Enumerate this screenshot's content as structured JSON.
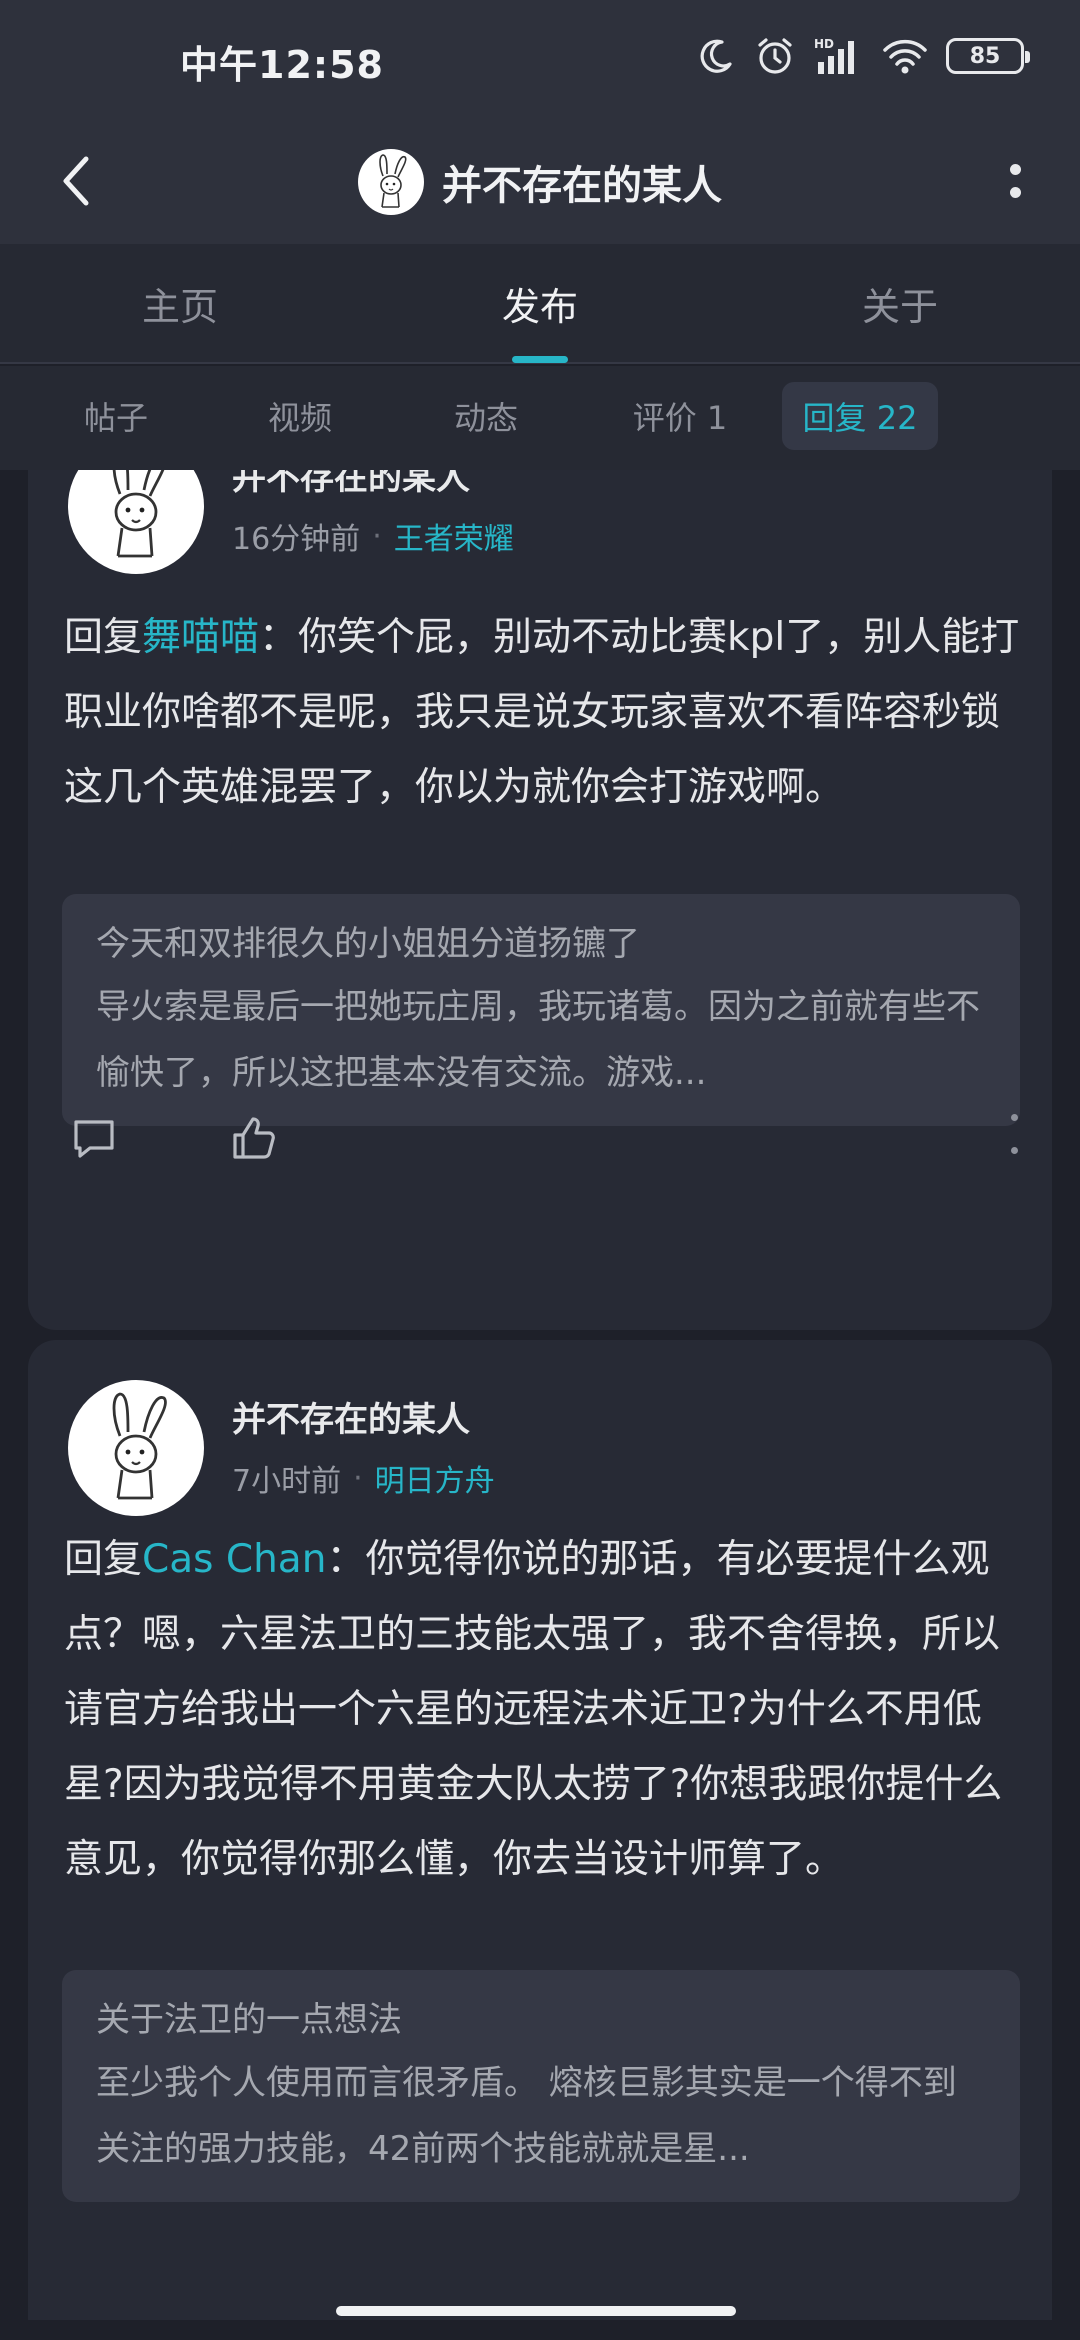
{
  "status_bar": {
    "time": "中午12:58",
    "network_label": "HD",
    "battery": "85"
  },
  "nav": {
    "title": "并不存在的某人"
  },
  "main_tabs": [
    "主页",
    "发布",
    "关于"
  ],
  "main_tabs_active": "发布",
  "sub_tabs": [
    "帖子",
    "视频",
    "动态",
    "评价 1",
    "回复 22"
  ],
  "sub_tabs_active": "回复 22",
  "posts": [
    {
      "author": "并不存在的某人",
      "time": "16分钟前",
      "topic": "王者荣耀",
      "reply_prefix": "回复",
      "mention": "舞喵喵",
      "text": "：你笑个屁，别动不动比赛kpl了，别人能打职业你啥都不是呢，我只是说女玩家喜欢不看阵容秒锁这几个英雄混罢了，你以为就你会打游戏啊。",
      "quote_title": "今天和双排很久的小姐姐分道扬镳了",
      "quote_body": "导火索是最后一把她玩庄周，我玩诸葛。因为之前就有些不愉快了，所以这把基本没有交流。游戏..."
    },
    {
      "author": "并不存在的某人",
      "time": "7小时前",
      "topic": "明日方舟",
      "reply_prefix": "回复",
      "mention": "Cas Chan",
      "text": "：你觉得你说的那话，有必要提什么观点？嗯，六星法卫的三技能太强了，我不舍得换，所以请官方给我出一个六星的远程法术近卫?为什么不用低星?因为我觉得不用黄金大队太捞了?你想我跟你提什么意见，你觉得你那么懂，你去当设计师算了。",
      "quote_title": "关于法卫的一点想法",
      "quote_body": "至少我个人使用而言很矛盾。 熔核巨影其实是一个得不到关注的强力技能，42前两个技能就就是星..."
    }
  ],
  "colors": {
    "accent": "#27b6c8",
    "background": "#1e2029",
    "card": "#272a35",
    "header": "#2e313c"
  }
}
